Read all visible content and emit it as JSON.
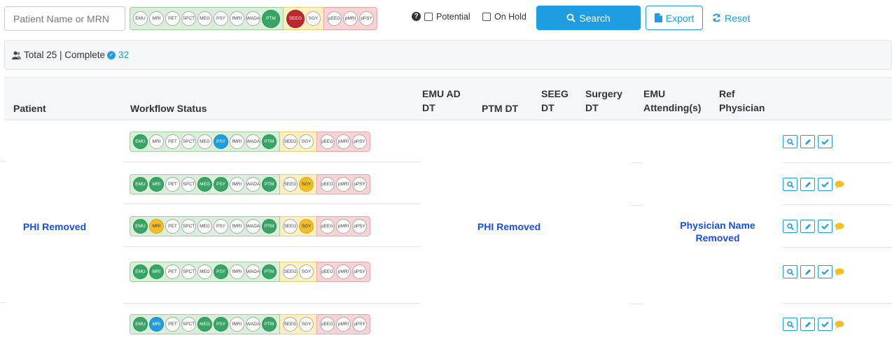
{
  "toolbar": {
    "search_placeholder": "Patient Name or MRN",
    "filters": {
      "green": [
        "EMU",
        "MRI",
        "PET",
        "SPCT",
        "MEG",
        "PSY",
        "fMRI",
        "WADA",
        "PTM"
      ],
      "yellow": [
        "SEEG",
        "SGY"
      ],
      "red": [
        "pEEG",
        "pMRI",
        "pPSY"
      ]
    },
    "filter_states": {
      "PTM": "green",
      "SEEG": "red"
    },
    "potential_label": "Potential",
    "on_hold_label": "On Hold",
    "search_label": "Search",
    "export_label": "Export",
    "reset_label": "Reset"
  },
  "summary": {
    "total_text": "Total 25 | Complete",
    "complete_count": "32"
  },
  "columns": {
    "patient": "Patient",
    "workflow": "Workflow Status",
    "emu_ad_dt": [
      "EMU AD",
      "DT"
    ],
    "ptm_dt": "PTM DT",
    "seeg_dt": [
      "SEEG",
      "DT"
    ],
    "surgery_dt": [
      "Surgery",
      "DT"
    ],
    "emu_attending": [
      "EMU",
      "Attending(s)"
    ],
    "ref_physician": [
      "Ref",
      "Physician"
    ]
  },
  "patient_name": "PHI Removed",
  "dates_text": "PHI Removed",
  "physician_text": [
    "Physician Name",
    "Removed"
  ],
  "rows": [
    {
      "states": {
        "EMU": "green",
        "PSY": "blue",
        "PTM": "green"
      },
      "comment": false
    },
    {
      "states": {
        "EMU": "green",
        "MRI": "green",
        "MEG": "green",
        "PSY": "green",
        "PTM": "green",
        "SGY": "yellow"
      },
      "comment": true
    },
    {
      "states": {
        "EMU": "green",
        "MRI": "yellow",
        "PTM": "green",
        "SGY": "yellow"
      },
      "comment": true
    },
    {
      "states": {
        "EMU": "green",
        "MRI": "green",
        "PSY": "green",
        "PTM": "green"
      },
      "comment": true
    },
    {
      "states": {
        "EMU": "green",
        "MRI": "blue",
        "MEG": "green",
        "PSY": "green",
        "PTM": "green"
      },
      "comment": true
    }
  ],
  "colors": {
    "accent": "#1e9de2",
    "link": "#1b4fd8",
    "green": "#37a565",
    "blue": "#1e9ddf",
    "yellow": "#f2bd27",
    "red": "#b9292f"
  },
  "icons": [
    "help-icon",
    "search-icon",
    "file-icon",
    "refresh-icon",
    "users-icon",
    "check-circle-icon",
    "magnifier-icon",
    "pencil-icon",
    "check-icon",
    "comment-icon"
  ]
}
